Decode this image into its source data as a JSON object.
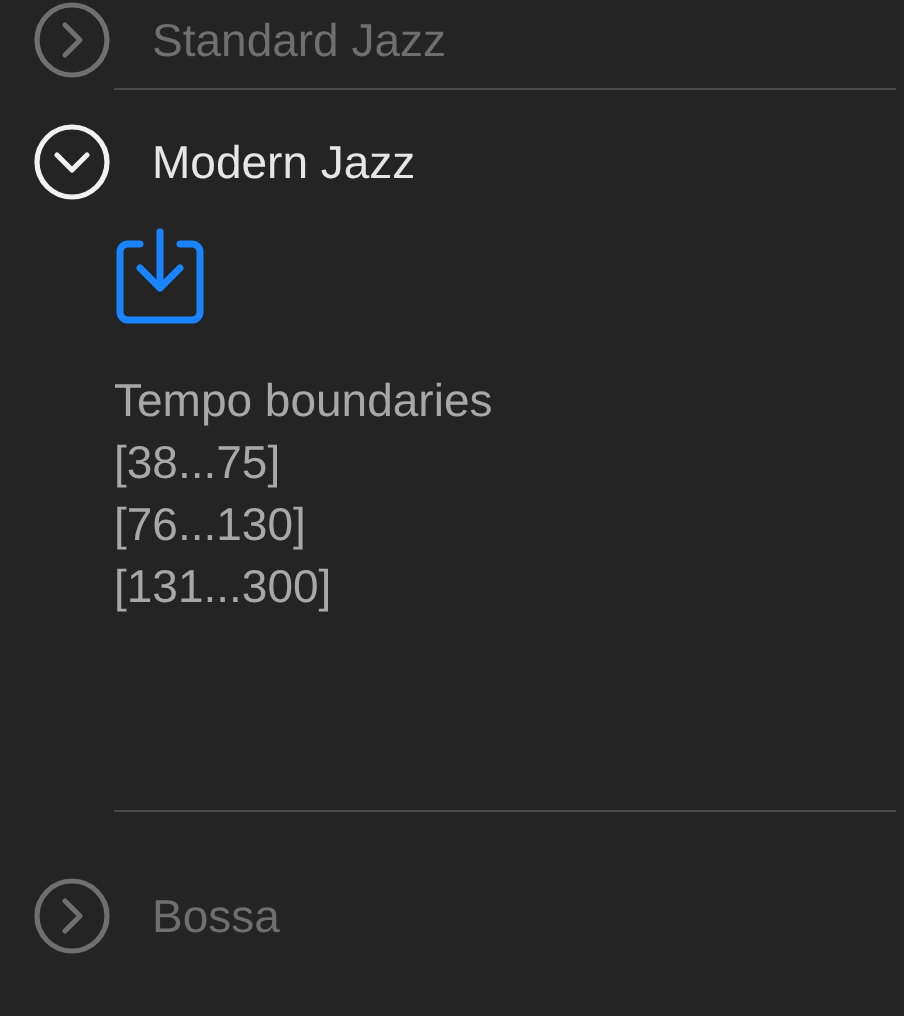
{
  "sections": [
    {
      "title": "Standard Jazz",
      "expanded": false
    },
    {
      "title": "Modern Jazz",
      "expanded": true,
      "content": {
        "heading": "Tempo boundaries",
        "lines": [
          "[38...75]",
          "[76...130]",
          "[131...300]"
        ]
      }
    },
    {
      "title": "Bossa",
      "expanded": false
    }
  ]
}
